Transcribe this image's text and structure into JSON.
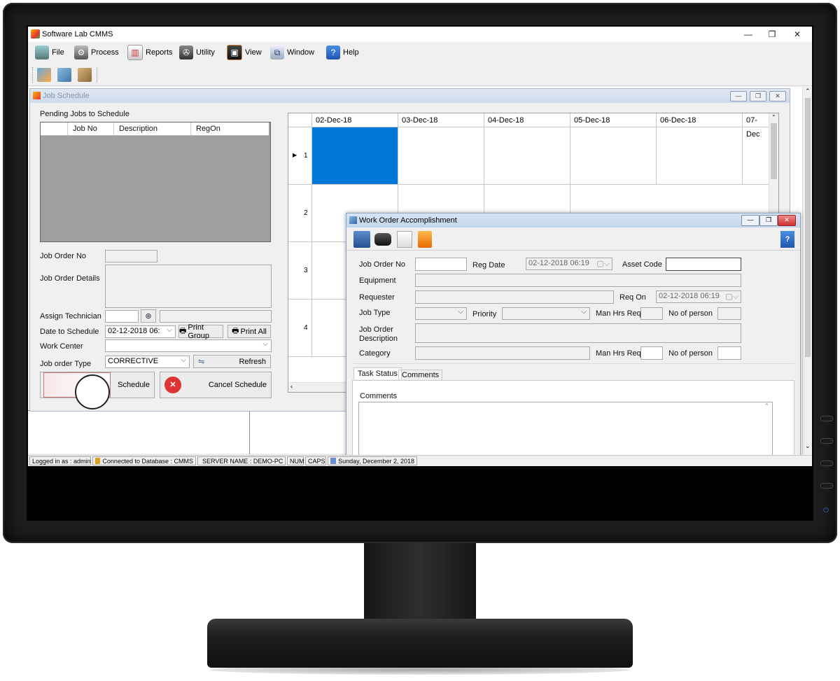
{
  "app": {
    "title": "Software Lab CMMS"
  },
  "window_controls": {
    "minimize": "—",
    "restore": "❐",
    "close": "✕"
  },
  "menu": [
    "File",
    "Process",
    "Reports",
    "Utility",
    "View",
    "Window",
    "Help"
  ],
  "job_schedule": {
    "title": "Job Schedule",
    "pending_label": "Pending Jobs to Schedule",
    "pending_columns": [
      "Job No",
      "Description",
      "RegOn"
    ],
    "job_order_no_label": "Job Order No",
    "job_order_details_label": "Job Order Details",
    "assign_technician_label": "Assign Technician",
    "date_to_schedule_label": "Date to Schedule",
    "date_to_schedule_value": "02-12-2018 06:",
    "print_group": "Print Group",
    "print_all": "Print All",
    "work_center_label": "Work Center",
    "job_order_type_label": "Job order Type",
    "job_order_type_value": "CORRECTIVE",
    "refresh": "Refresh",
    "schedule": "Schedule",
    "cancel_schedule": "Cancel Schedule",
    "grid_dates": [
      "02-Dec-18",
      "03-Dec-18",
      "04-Dec-18",
      "05-Dec-18",
      "06-Dec-18",
      "07-Dec"
    ],
    "grid_rows": [
      "1",
      "2",
      "3",
      "4"
    ]
  },
  "work_order": {
    "title": "Work Order Accomplishment",
    "job_order_no_label": "Job Order No",
    "reg_date_label": "Reg Date",
    "reg_date_value": "02-12-2018 06:19",
    "asset_code_label": "Asset Code",
    "equipment_label": "Equipment",
    "requester_label": "Requester",
    "req_on_label": "Req On",
    "req_on_value": "02-12-2018 06:19",
    "job_type_label": "Job Type",
    "priority_label": "Priority",
    "man_hrs_label": "Man Hrs Req",
    "no_person_label": "No of person",
    "job_order_desc_label_1": "Job Order",
    "job_order_desc_label_2": "Description",
    "category_label": "Category",
    "tabs": [
      "Task Status",
      "Comments"
    ],
    "comments_label": "Comments"
  },
  "statusbar": {
    "logged_in": "Logged in as : admin",
    "database": "Connected to Database : CMMS",
    "server": "SERVER NAME : DEMO-PC",
    "num": "NUM",
    "caps": "CAPS",
    "date": "Sunday, December 2, 2018"
  },
  "colors": {
    "selection": "#0078d7",
    "pending_list_bg": "#a0a0a0",
    "title_active": "#c2d5ec"
  }
}
